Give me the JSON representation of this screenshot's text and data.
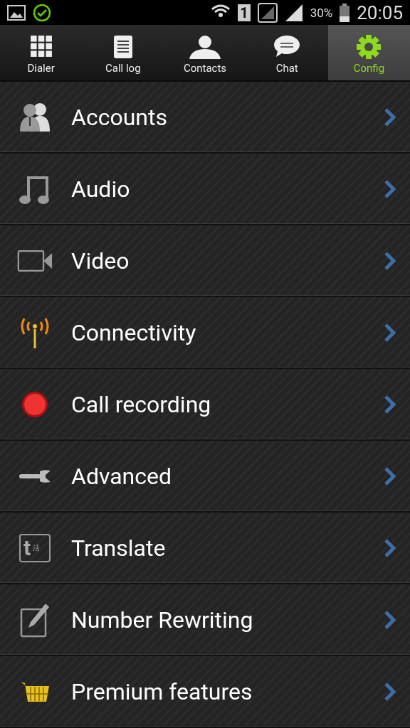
{
  "status_bar": {
    "sim_slot": "1",
    "battery_percent": "30%",
    "time": "20:05"
  },
  "tabs": [
    {
      "label": "Dialer",
      "kind": "dialer",
      "selected": false
    },
    {
      "label": "Call log",
      "kind": "calllog",
      "selected": false
    },
    {
      "label": "Contacts",
      "kind": "contacts",
      "selected": false
    },
    {
      "label": "Chat",
      "kind": "chat",
      "selected": false
    },
    {
      "label": "Config",
      "kind": "config",
      "selected": true
    }
  ],
  "menu_items": [
    {
      "label": "Accounts",
      "kind": "accounts"
    },
    {
      "label": "Audio",
      "kind": "audio"
    },
    {
      "label": "Video",
      "kind": "video"
    },
    {
      "label": "Connectivity",
      "kind": "connectivity"
    },
    {
      "label": "Call recording",
      "kind": "recording"
    },
    {
      "label": "Advanced",
      "kind": "advanced"
    },
    {
      "label": "Translate",
      "kind": "translate",
      "icon_glyphs": [
        "t",
        "活"
      ]
    },
    {
      "label": "Number Rewriting",
      "kind": "rewriting"
    },
    {
      "label": "Premium features",
      "kind": "premium"
    }
  ]
}
